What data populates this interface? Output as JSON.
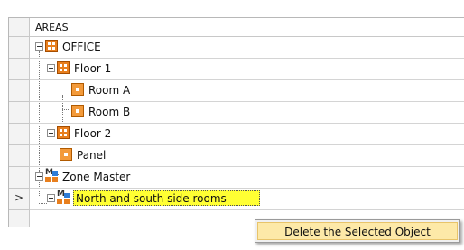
{
  "tree": {
    "header": "AREAS",
    "rows": [
      {
        "label": "OFFICE",
        "icon": "area-grid-icon",
        "expander": "minus"
      },
      {
        "label": "Floor 1",
        "icon": "area-grid-icon",
        "expander": "minus"
      },
      {
        "label": "Room A",
        "icon": "room-icon",
        "expander": ""
      },
      {
        "label": "Room B",
        "icon": "room-icon",
        "expander": ""
      },
      {
        "label": "Floor 2",
        "icon": "area-grid-icon",
        "expander": "plus"
      },
      {
        "label": "Panel",
        "icon": "room-icon",
        "expander": ""
      },
      {
        "label": "Zone Master",
        "icon": "zone-master-icon",
        "expander": "minus"
      },
      {
        "label": "North and south side rooms",
        "icon": "zone-master-icon",
        "expander": "plus"
      }
    ],
    "current_row_marker": ">"
  },
  "context_menu": {
    "items": [
      {
        "label": "Delete the Selected Object"
      }
    ]
  },
  "colors": {
    "selection_highlight": "#ffff33",
    "menu_item_hover": "#fde9a8",
    "area_icon": "#e87f1e",
    "zone_blue": "#2e7cd6"
  }
}
